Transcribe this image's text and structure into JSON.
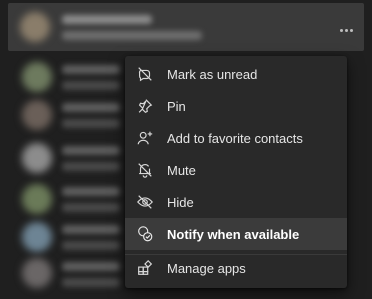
{
  "menu": {
    "items": [
      {
        "label": "Mark as unread",
        "icon": "mark-unread-icon"
      },
      {
        "label": "Pin",
        "icon": "pin-icon"
      },
      {
        "label": "Add to favorite contacts",
        "icon": "add-contact-icon"
      },
      {
        "label": "Mute",
        "icon": "mute-bell-icon"
      },
      {
        "label": "Hide",
        "icon": "hide-eye-icon"
      },
      {
        "label": "Notify when available",
        "icon": "notify-available-icon",
        "highlighted": true
      },
      {
        "label": "Manage apps",
        "icon": "apps-icon"
      }
    ]
  },
  "colors": {
    "background": "#1f1f1f",
    "selected_row": "#3a3a3a",
    "menu_background": "#292929",
    "menu_highlight": "#3b3b3b",
    "text": "#e6e6e6"
  }
}
